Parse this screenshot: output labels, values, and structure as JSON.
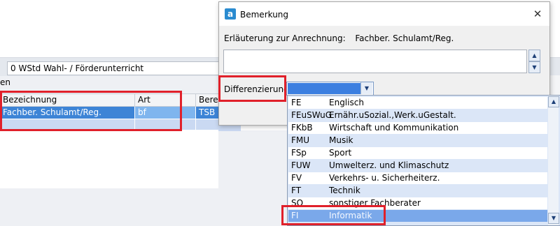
{
  "background": {
    "wstd_field": "0 WStd Wahl- / Förderunterricht",
    "section_label": "en",
    "grid": {
      "headers": [
        "Bezeichnung",
        "Art",
        "Bereich"
      ],
      "rows": [
        [
          "Fachber. Schulamt/Reg.",
          "bf",
          "TSB"
        ],
        [
          "",
          "",
          ""
        ]
      ]
    }
  },
  "dialog": {
    "logo": "a",
    "title": "Bemerkung",
    "close_icon": "close-icon",
    "hint_label": "Erläuterung zur Anrechnung:",
    "hint_value": "Fachber. Schulamt/Reg.",
    "differenzierung_label": "Differenzierung"
  },
  "dropdown": {
    "selected_code": "FI",
    "items": [
      {
        "code": "FE",
        "name": "Englisch"
      },
      {
        "code": "FEuSWuG",
        "name": "Ernähr.uSozial.,Werk.uGestalt."
      },
      {
        "code": "FKbB",
        "name": "Wirtschaft und Kommunikation"
      },
      {
        "code": "FMU",
        "name": "Musik"
      },
      {
        "code": "FSp",
        "name": "Sport"
      },
      {
        "code": "FUW",
        "name": "Umwelterz. und Klimaschutz"
      },
      {
        "code": "FV",
        "name": "Verkehrs- u. Sicherheiterz."
      },
      {
        "code": "FT",
        "name": "Technik"
      },
      {
        "code": "SO",
        "name": "sonstiger Fachberater"
      },
      {
        "code": "FI",
        "name": "Informatik"
      }
    ]
  },
  "colors": {
    "highlight": "#e0202a",
    "selection": "#3d84d6",
    "dropdown_selection": "#7aa8ea"
  }
}
